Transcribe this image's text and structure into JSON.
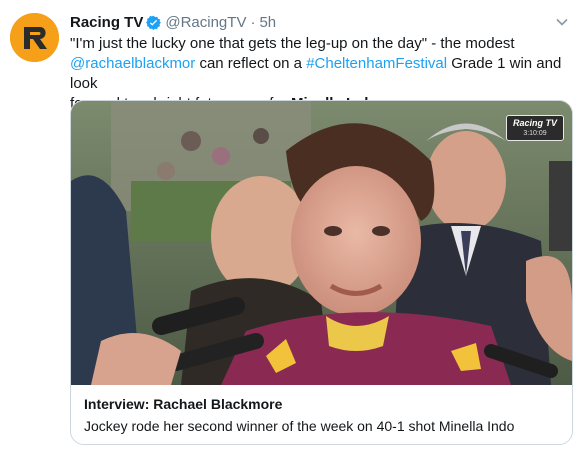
{
  "account": {
    "name": "Racing TV",
    "handle": "@RacingTV",
    "separator": "·",
    "time": "5h",
    "verified": true,
    "avatar_icon": "racing-tv-logo",
    "avatar_color": "#f6a01a"
  },
  "tweet": {
    "line1": "\"I'm just the lucky one that gets the leg-up on the day\" - the modest",
    "mention": "@rachaelblackmor",
    "mid_text": " can reflect on a ",
    "hashtag": "#CheltenhamFestival",
    "after_hashtag": " Grade 1 win and look",
    "line3_start": "forward to a bright future now for ",
    "bold_name": "Minella Indo"
  },
  "card": {
    "watermark_brand": "Racing TV",
    "watermark_time": "3:10:09",
    "title": "Interview: Rachael Blackmore",
    "description": "Jockey rode her second winner of the week on 40-1 shot Minella Indo"
  },
  "colors": {
    "link": "#1da1f2",
    "secondary_text": "#657786",
    "border": "#ccd6dd"
  }
}
